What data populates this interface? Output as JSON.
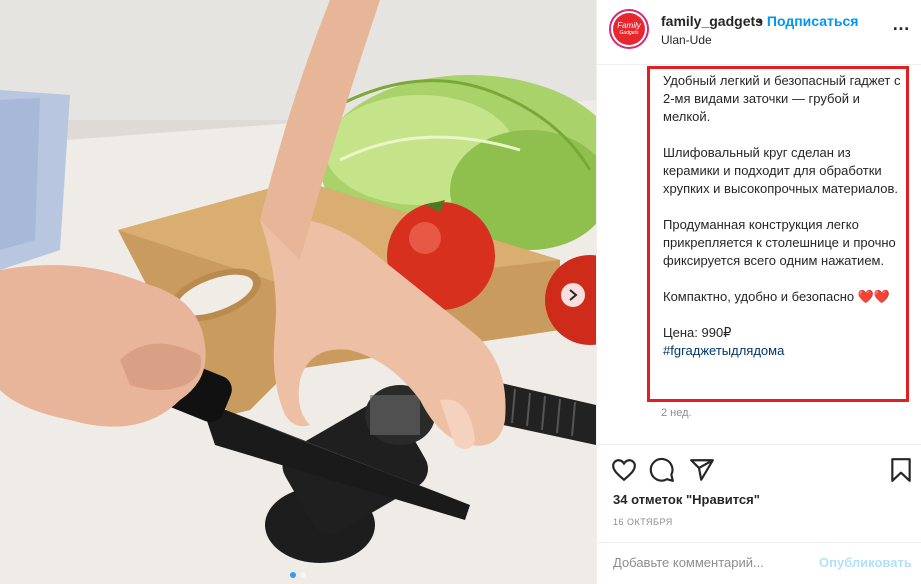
{
  "post": {
    "username": "family_gadgets",
    "separator": "•",
    "follow_label": "Подписаться",
    "location": "Ulan-Ude",
    "more_label": "…",
    "avatar_text_1": "Family",
    "avatar_text_2": "Gadgets"
  },
  "caption": {
    "paragraphs": [
      "Удобный легкий и безопасный гаджет с 2-мя видами заточки — грубой и мелкой.",
      "Шлифовальный круг сделан из керамики и подходит для обработки хрупких и высокопрочных материалов.",
      "Продуманная конструкция легко прикрепляется к столешнице и прочно фиксируется всего одним нажатием.",
      "Компактно, удобно и безопасно ❤️❤️",
      "Цена: 990₽"
    ],
    "hashtag": "#fgгаджетыдлядома",
    "time_ago": "2 нед."
  },
  "actions": {
    "likes": "34 отметок \"Нравится\"",
    "date": "16 ОКТЯБРЯ",
    "comment_placeholder": "Добавьте комментарий...",
    "publish_label": "Опубликовать",
    "icons": [
      "heart-icon",
      "comment-icon",
      "share-icon",
      "bookmark-icon"
    ]
  },
  "carousel": {
    "slide_count": 2,
    "active_index": 0
  },
  "colors": {
    "accent": "#0095f6",
    "highlight_border": "#e02020",
    "hashtag": "#00376b",
    "muted": "#8e8e8e"
  }
}
